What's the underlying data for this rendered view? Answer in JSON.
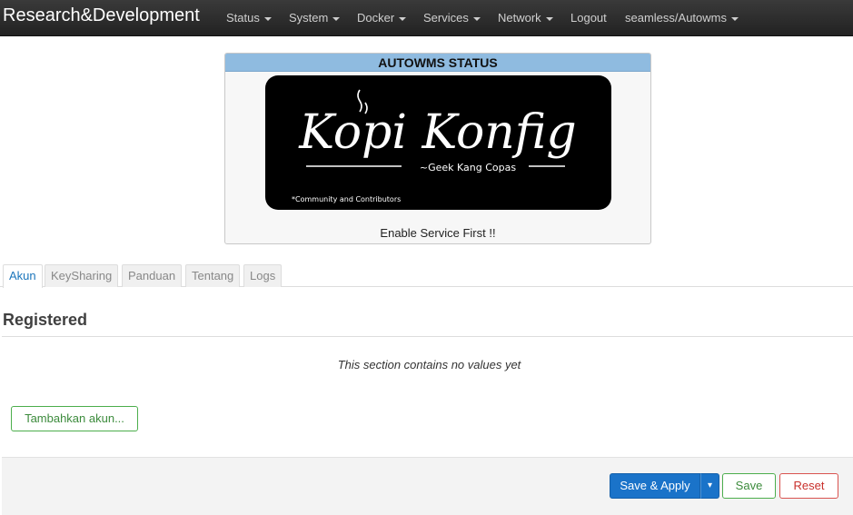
{
  "navbar": {
    "brand": "Research&Development",
    "items": [
      {
        "label": "Status"
      },
      {
        "label": "System"
      },
      {
        "label": "Docker"
      },
      {
        "label": "Services"
      },
      {
        "label": "Network"
      },
      {
        "label": "Logout"
      },
      {
        "label": "seamless/Autowms"
      }
    ]
  },
  "status_panel": {
    "title": "AUTOWMS STATUS",
    "logo": {
      "title": "Kopi Konfig",
      "tagline": "~Geek Kang Copas",
      "footnote": "*Community and Contributors"
    },
    "message": "Enable Service First !!"
  },
  "tabs": [
    {
      "label": "Akun"
    },
    {
      "label": "KeySharing"
    },
    {
      "label": "Panduan"
    },
    {
      "label": "Tentang"
    },
    {
      "label": "Logs"
    }
  ],
  "section": {
    "title": "Registered",
    "empty_message": "This section contains no values yet",
    "add_button": "Tambahkan akun..."
  },
  "actions": {
    "save_apply": "Save & Apply",
    "split_arrow": "▾",
    "save": "Save",
    "reset": "Reset"
  },
  "colors": {
    "navbar": "#2b2b2b",
    "panel_header": "#8fbbe0",
    "primary": "#1a73c9",
    "success": "#4cae4c",
    "danger": "#d9534f",
    "active_tab_text": "#1b75bb"
  }
}
